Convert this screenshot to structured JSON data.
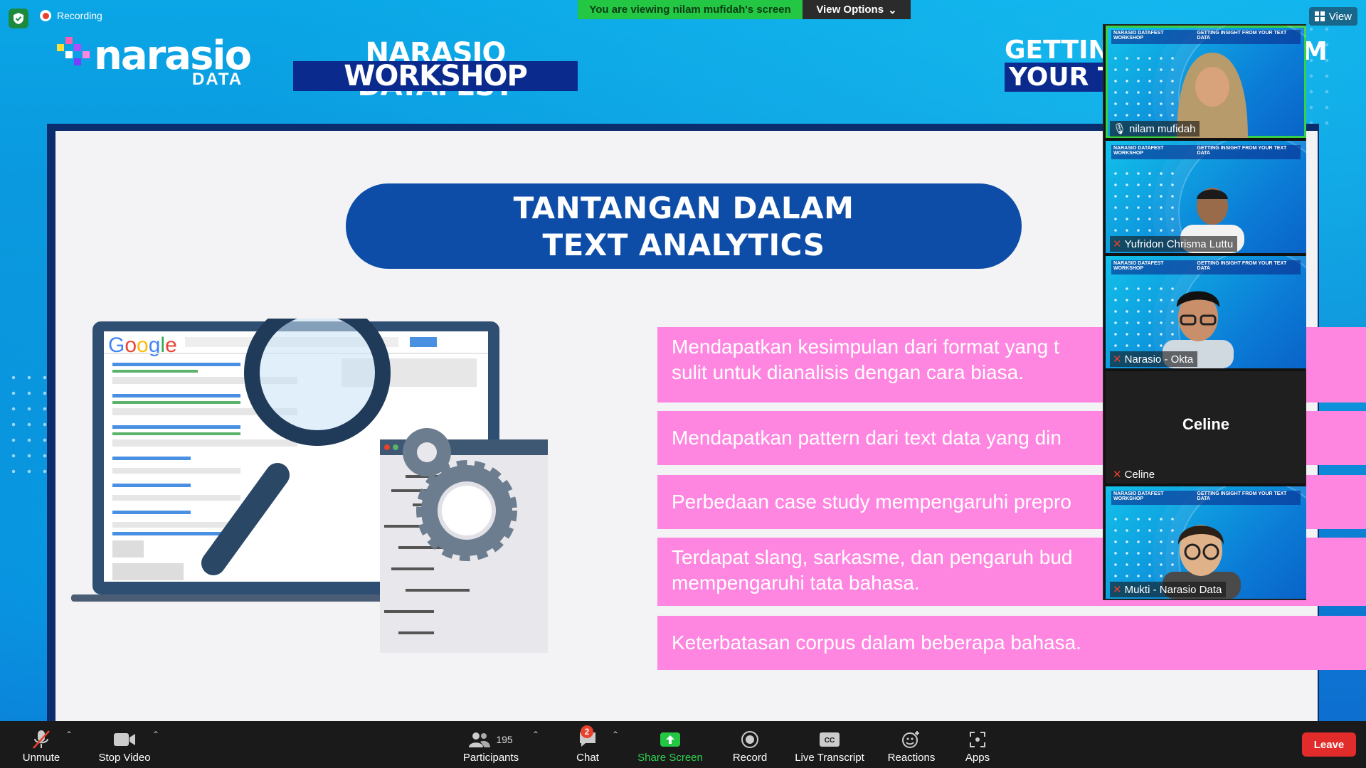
{
  "top": {
    "recording_label": "Recording",
    "viewing_text": "You are viewing nilam mufidah's screen",
    "view_options_label": "View Options",
    "view_label": "View"
  },
  "slide": {
    "logo_text": "narasio",
    "logo_sub": "DATA",
    "event_line1": "NARASIO DATAFEST",
    "event_line2": "WORKSHOP",
    "side_title_line1": "GETTIN",
    "side_title_line2": "YOUR T",
    "side_title_tail": "M",
    "title_line1": "TANTANGAN DALAM",
    "title_line2": "TEXT ANALYTICS",
    "google_label": "Google",
    "bullets": [
      {
        "line1": "Mendapatkan kesimpulan dari format yang t",
        "line2": "sulit untuk dianalisis dengan cara biasa."
      },
      {
        "line1": "Mendapatkan pattern dari text data yang din",
        "line2": ""
      },
      {
        "line1": "Perbedaan case study mempengaruhi prepro",
        "line2": ""
      },
      {
        "line1": "Terdapat slang, sarkasme, dan pengaruh bud",
        "line2": "mempengaruhi tata bahasa."
      },
      {
        "line1": "Keterbatasan corpus dalam beberapa bahasa.",
        "line2": ""
      }
    ]
  },
  "participants_panel": {
    "mini_slide_left": "NARASIO DATAFEST WORKSHOP",
    "mini_slide_right": "GETTING INSIGHT FROM YOUR TEXT DATA",
    "tiles": [
      {
        "name": "nilam mufidah",
        "muted": false,
        "speaking": true
      },
      {
        "name": "Yufridon Chrisma Luttu",
        "muted": true,
        "speaking": false
      },
      {
        "name": "Narasio - Okta",
        "muted": true,
        "speaking": false
      },
      {
        "name": "Celine",
        "muted": true,
        "speaking": false,
        "video_off": true,
        "center_name": "Celine"
      },
      {
        "name": "Mukti - Narasio Data",
        "muted": true,
        "speaking": false
      }
    ]
  },
  "toolbar": {
    "unmute": "Unmute",
    "stop_video": "Stop Video",
    "participants": "Participants",
    "participants_count": "195",
    "chat": "Chat",
    "chat_badge": "2",
    "share_screen": "Share Screen",
    "record": "Record",
    "live_transcript": "Live Transcript",
    "reactions": "Reactions",
    "apps": "Apps",
    "leave": "Leave"
  },
  "colors": {
    "share_green": "#23c744",
    "leave_red": "#e22b2b",
    "bullet_pink": "#ff86e0",
    "title_blue": "#0d4da8"
  }
}
